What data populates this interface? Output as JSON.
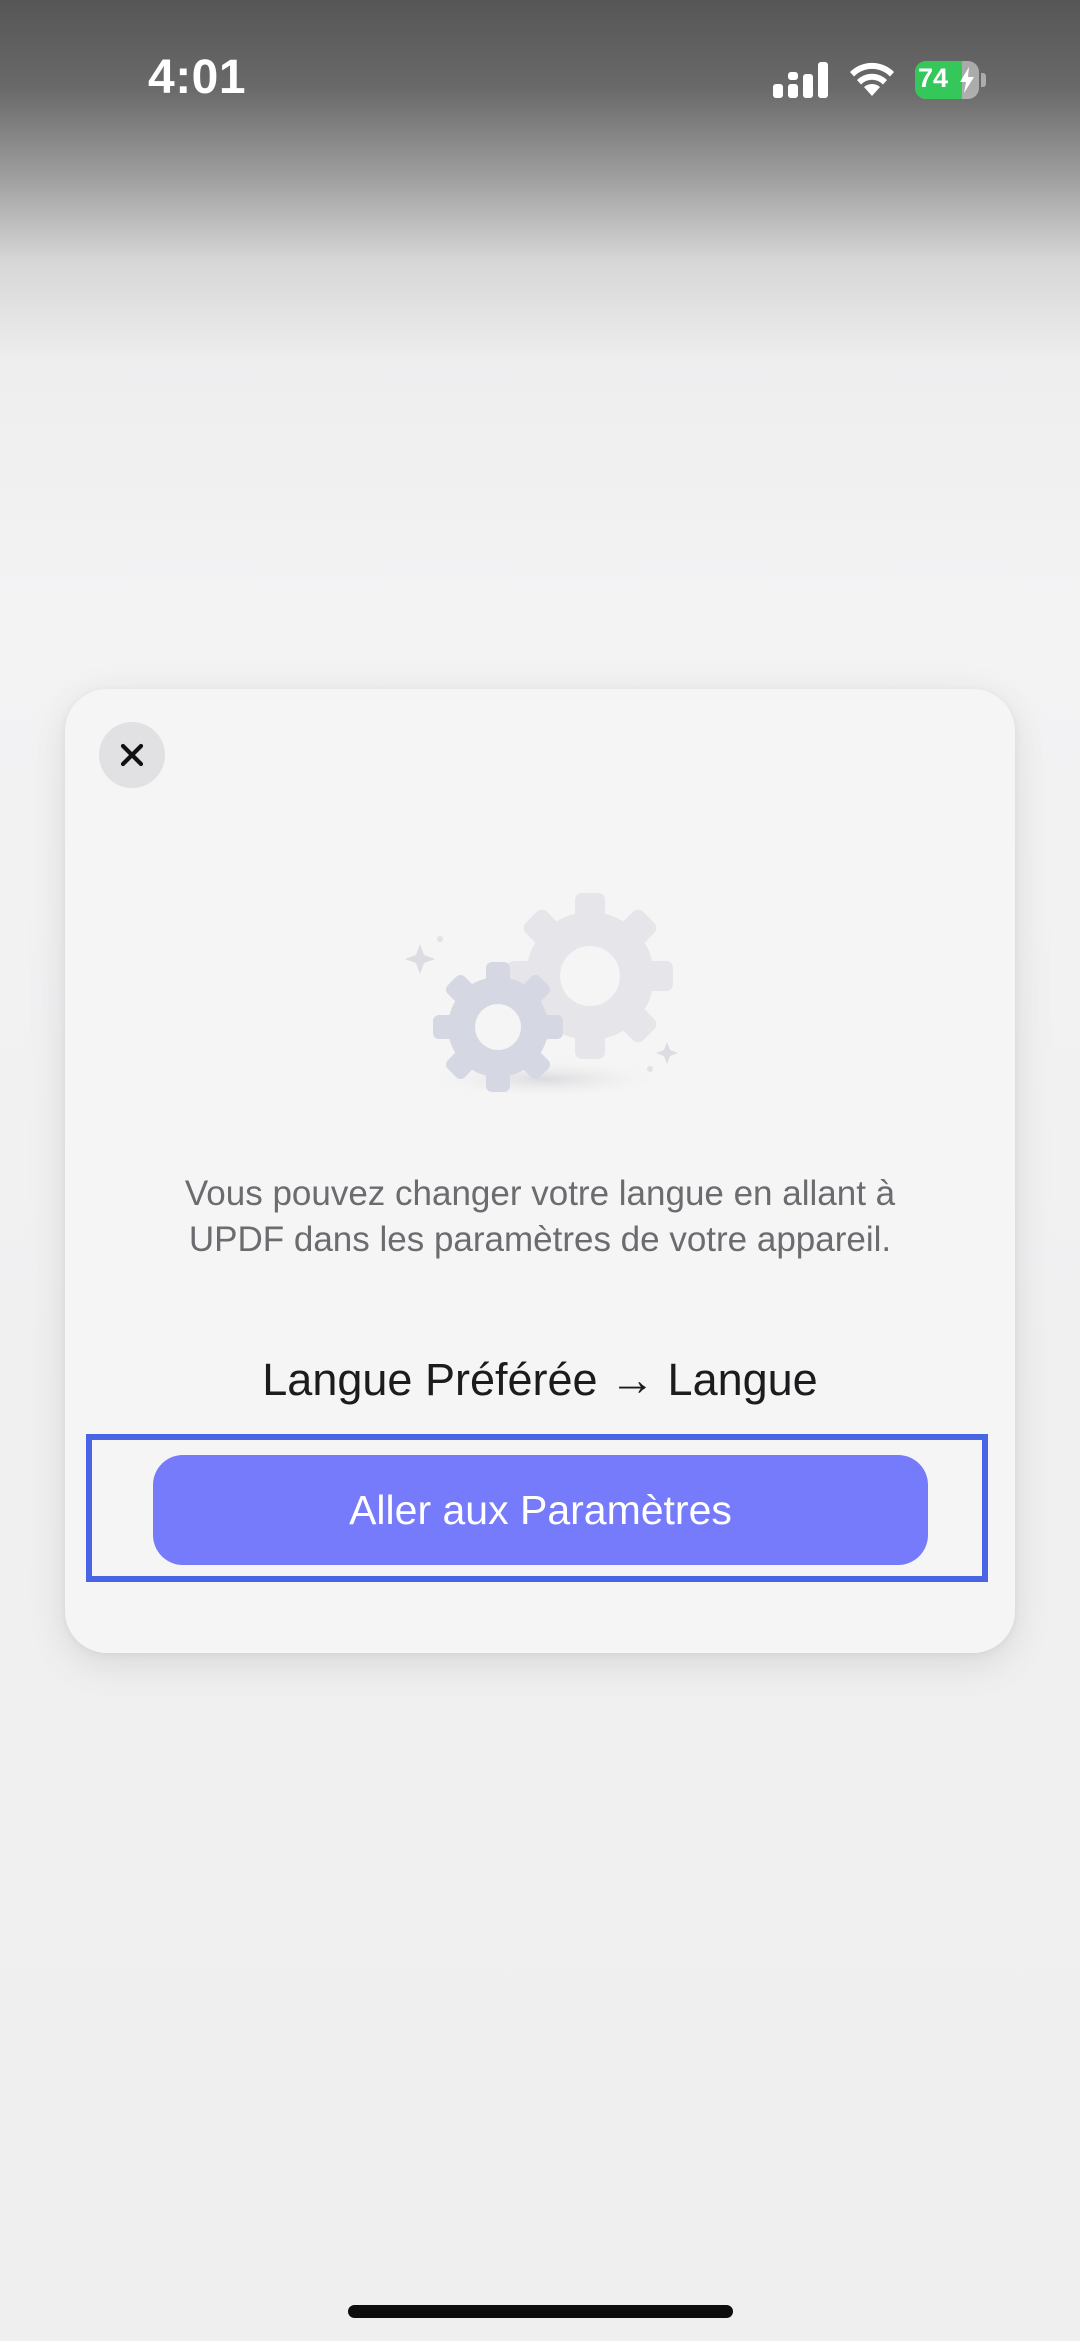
{
  "status_bar": {
    "time": "4:01",
    "battery_level": "74",
    "battery_fraction": 0.74,
    "battery_color": "#34c759",
    "icons": [
      "cellular-signal-icon",
      "wifi-icon",
      "battery-icon",
      "charging-bolt-icon"
    ]
  },
  "dialog": {
    "close_icon": "close-icon",
    "illustration": "gears-icon",
    "message": "Vous pouvez changer votre langue en allant à UPDF dans les paramètres de votre appareil.",
    "settings_path": "Langue Préférée → Langue",
    "button_label": "Aller aux Paramètres",
    "button_color": "#767bfc",
    "highlight_color": "#4965e6"
  }
}
